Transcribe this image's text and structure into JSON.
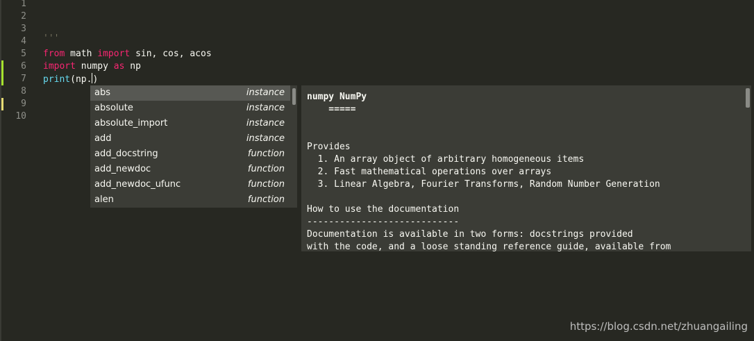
{
  "editor": {
    "line_numbers": [
      "1",
      "2",
      "3",
      "4",
      "5",
      "6",
      "7",
      "8",
      "9",
      "10"
    ],
    "lines": {
      "l1": "'''",
      "l4": "'''",
      "l5": {
        "kw1": "from",
        "mod": " math ",
        "kw2": "import",
        "rest": " sin, cos, acos"
      },
      "l6": {
        "kw1": "import",
        "mod": " numpy ",
        "kw2": "as",
        "rest": " np"
      },
      "l7": {
        "fn": "print",
        "rest_before": "(np.",
        "rest_after": ")"
      }
    },
    "colors": {
      "background": "#272822",
      "keyword": "#f92672",
      "function": "#66d9ef",
      "comment": "#75715e",
      "modified_marker": "#a6e22e",
      "unsaved_marker": "#e6db74"
    }
  },
  "autocomplete": {
    "items": [
      {
        "name": "abs",
        "kind": "instance"
      },
      {
        "name": "absolute",
        "kind": "instance"
      },
      {
        "name": "absolute_import",
        "kind": "instance"
      },
      {
        "name": "add",
        "kind": "instance"
      },
      {
        "name": "add_docstring",
        "kind": "function"
      },
      {
        "name": "add_newdoc",
        "kind": "function"
      },
      {
        "name": "add_newdoc_ufunc",
        "kind": "function"
      },
      {
        "name": "alen",
        "kind": "function"
      }
    ],
    "selected_index": 0
  },
  "doc_popup": {
    "title": "numpy NumPy",
    "underline": "    =====",
    "lines": [
      "",
      "",
      "Provides",
      "  1. An array object of arbitrary homogeneous items",
      "  2. Fast mathematical operations over arrays",
      "  3. Linear Algebra, Fourier Transforms, Random Number Generation",
      "",
      "How to use the documentation",
      "----------------------------",
      "Documentation is available in two forms: docstrings provided",
      "with the code, and a loose standing reference guide, available from"
    ]
  },
  "watermark": "https://blog.csdn.net/zhuangailing"
}
